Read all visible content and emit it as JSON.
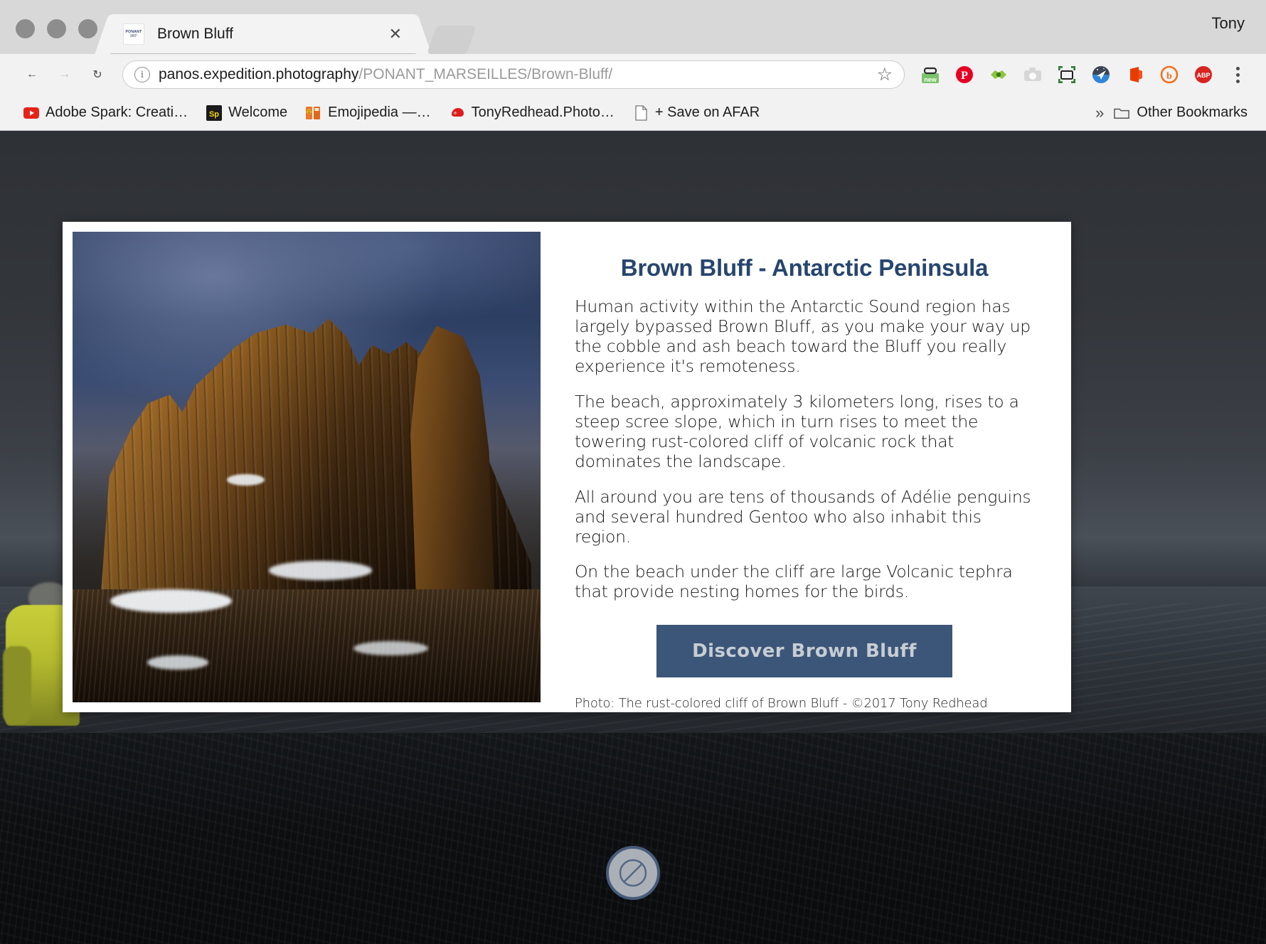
{
  "window": {
    "profile_name": "Tony"
  },
  "tab": {
    "title": "Brown Bluff",
    "favicon_line1": "PONANT",
    "favicon_line2": "360°",
    "close_label": "✕"
  },
  "toolbar": {
    "back_icon": "←",
    "forward_icon": "→",
    "reload_icon": "↻",
    "info_icon": "i",
    "url_host": "panos.expedition.photography",
    "url_path": "/PONANT_MARSEILLES/Brown-Bluff/",
    "bookmark_star": "☆",
    "extensions": [
      {
        "name": "new-tab-manager-icon",
        "glyph": "new"
      },
      {
        "name": "pinterest-icon",
        "glyph": "P"
      },
      {
        "name": "evernote-web-clipper-icon",
        "glyph": "◆"
      },
      {
        "name": "screenshot-camera-icon",
        "glyph": "▣"
      },
      {
        "name": "fullpage-capture-icon",
        "glyph": "▭"
      },
      {
        "name": "pocket-navigator-icon",
        "glyph": "➤"
      },
      {
        "name": "microsoft-office-icon",
        "glyph": "◧"
      },
      {
        "name": "hootsuite-icon",
        "glyph": "b"
      },
      {
        "name": "adblock-plus-icon",
        "glyph": "ABP"
      }
    ]
  },
  "bookmarks": {
    "items": [
      {
        "label": "Adobe Spark: Creati…",
        "icon": "youtube-icon",
        "glyph": "▶"
      },
      {
        "label": "Welcome",
        "icon": "adobe-spark-icon",
        "glyph": "Sp"
      },
      {
        "label": "Emojipedia —…",
        "icon": "emojipedia-icon",
        "glyph": "😀"
      },
      {
        "label": "TonyRedhead.Photo…",
        "icon": "tonyredhead-icon",
        "glyph": "●"
      },
      {
        "label": "+ Save on AFAR",
        "icon": "page-icon",
        "glyph": "❐"
      }
    ],
    "overflow_chevron": "»",
    "other_bookmarks_label": "Other Bookmarks",
    "other_bookmarks_icon": "folder-icon"
  },
  "card": {
    "title": "Brown Bluff - Antarctic Peninsula",
    "paragraphs": [
      "Human activity within the Antarctic Sound region has largely bypassed Brown Bluff, as you make your way up the cobble and ash beach toward the Bluff you really experience it's remoteness.",
      "The beach, approximately 3 kilometers long, rises to a steep scree slope, which in turn rises to meet the towering rust-colored cliff of volcanic rock that dominates the landscape.",
      "All around you are tens of thousands of Adélie penguins and several hundred Gentoo who also inhabit this region.",
      "On the beach under the cliff are large Volcanic tephra that provide nesting homes for the birds."
    ],
    "button_label": "Discover Brown Bluff",
    "credit": "Photo: The rust-colored cliff of Brown Bluff - ©2017 Tony Redhead",
    "photo_alt": "rust-colored cliff of Brown Bluff"
  },
  "viewer": {
    "block_button_icon": "no-entry-icon"
  },
  "colors": {
    "accent_blue": "#27466f",
    "button_blue": "#3b5678",
    "button_text": "#c7cdd4",
    "chrome_gray": "#f2f2f2"
  }
}
